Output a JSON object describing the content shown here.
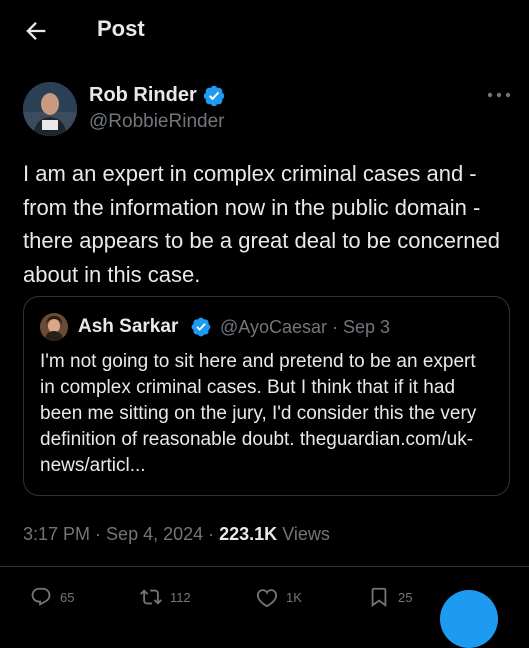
{
  "header": {
    "title": "Post"
  },
  "author": {
    "name": "Rob Rinder",
    "handle": "@RobbieRinder",
    "verified": true,
    "badge_color": "#1d9bf0"
  },
  "post": {
    "text": "I am an expert in complex criminal cases and - from the information now in the public domain - there appears to be a great deal to be concerned about in this case.",
    "time": "3:17 PM",
    "separator": " · ",
    "date": "Sep 4, 2024",
    "views_count": "223.1K",
    "views_label": "Views"
  },
  "quote": {
    "name": "Ash Sarkar",
    "handle": "@AyoCaesar",
    "date": "Sep 3",
    "text": "I'm not going to sit here and pretend to be an expert in complex criminal cases. But I think that if it had been me sitting on the jury, I'd consider this the very definition of reasonable doubt. theguardian.com/uk-news/articl..."
  },
  "actions": [
    {
      "name": "reply",
      "icon": "reply-icon",
      "count": "65"
    },
    {
      "name": "repost",
      "icon": "repost-icon",
      "count": "112"
    },
    {
      "name": "like",
      "icon": "heart-icon",
      "count": "1K"
    },
    {
      "name": "bookmark",
      "icon": "bookmark-icon",
      "count": "25"
    }
  ],
  "colors": {
    "background": "#000000",
    "text_primary": "#e7e9ea",
    "text_secondary": "#71767b",
    "border": "#2f3336",
    "accent": "#1d9bf0"
  }
}
